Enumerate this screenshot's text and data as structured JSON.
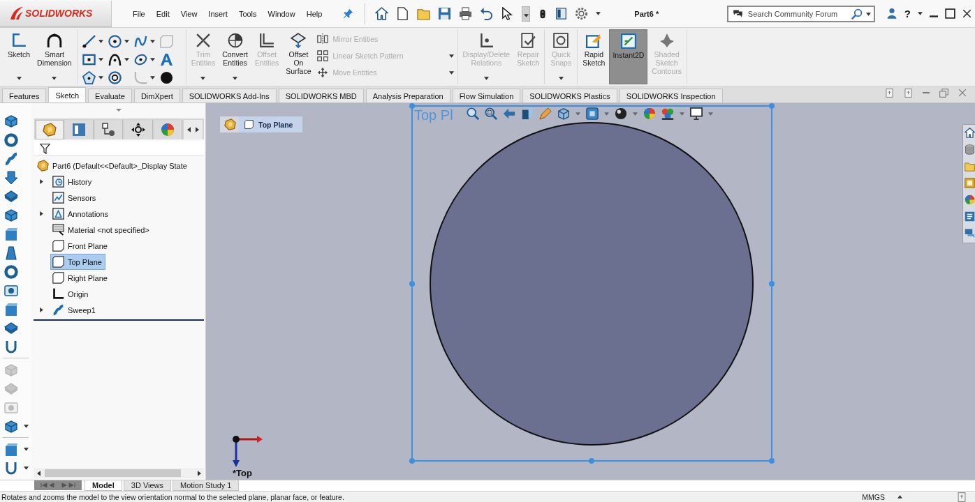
{
  "title_bar": {
    "logo": "SOLIDWORKS",
    "menu": [
      {
        "label": "File"
      },
      {
        "label": "Edit"
      },
      {
        "label": "View"
      },
      {
        "label": "Insert"
      },
      {
        "label": "Tools"
      },
      {
        "label": "Window"
      },
      {
        "label": "Help"
      }
    ],
    "document": "Part6 *",
    "search": {
      "placeholder": "Search Community Forum"
    },
    "help": "?"
  },
  "ribbon": {
    "sections": [
      {
        "items": [
          {
            "kind": "large",
            "label": "Sketch",
            "disabled": false,
            "selected": false,
            "dropdown": true
          },
          {
            "kind": "large",
            "label": "Smart Dimension",
            "disabled": false,
            "selected": false,
            "dropdown": true
          }
        ]
      },
      {
        "items": [
          {
            "kind": "tool",
            "disabled": false,
            "dropdown": true
          },
          {
            "kind": "tool",
            "disabled": false,
            "dropdown": true
          },
          {
            "kind": "tool",
            "disabled": false,
            "dropdown": true
          },
          {
            "kind": "tool",
            "disabled": true,
            "dropdown": false
          },
          {
            "kind": "tool",
            "disabled": false,
            "dropdown": true
          },
          {
            "kind": "tool",
            "disabled": false,
            "dropdown": true
          },
          {
            "kind": "tool",
            "disabled": false,
            "dropdown": true
          },
          {
            "kind": "tool",
            "disabled": false,
            "dropdown": false
          },
          {
            "kind": "tool",
            "disabled": false,
            "dropdown": true
          },
          {
            "kind": "tool",
            "disabled": false,
            "dropdown": false
          },
          {
            "kind": "tool",
            "disabled": true,
            "dropdown": true
          },
          {
            "kind": "tool",
            "disabled": false,
            "dropdown": false
          }
        ]
      },
      {
        "items": [
          {
            "kind": "large",
            "label": "Trim Entities",
            "disabled": true,
            "selected": false,
            "dropdown": true
          },
          {
            "kind": "large",
            "label": "Convert Entities",
            "disabled": false,
            "selected": false,
            "dropdown": true
          },
          {
            "kind": "large",
            "label": "Offset Entities",
            "disabled": true,
            "selected": false,
            "dropdown": false
          },
          {
            "kind": "large",
            "label": "Offset On Surface",
            "disabled": false,
            "selected": false,
            "dropdown": false
          },
          {
            "kind": "small",
            "label": "Mirror Entities",
            "disabled": true,
            "dropdown": false
          },
          {
            "kind": "small",
            "label": "Linear Sketch Pattern",
            "disabled": true,
            "dropdown": true
          },
          {
            "kind": "small",
            "label": "Move Entities",
            "disabled": true,
            "dropdown": true
          }
        ]
      },
      {
        "items": [
          {
            "kind": "large",
            "label": "Display/Delete Relations",
            "disabled": true,
            "selected": false,
            "dropdown": true
          },
          {
            "kind": "large",
            "label": "Repair Sketch",
            "disabled": true,
            "selected": false,
            "dropdown": false
          }
        ]
      },
      {
        "items": [
          {
            "kind": "large",
            "label": "Quick Snaps",
            "disabled": true,
            "selected": false,
            "dropdown": true
          }
        ]
      },
      {
        "items": [
          {
            "kind": "large",
            "label": "Rapid Sketch",
            "disabled": false,
            "selected": false,
            "dropdown": false
          },
          {
            "kind": "large",
            "label": "Instant2D",
            "disabled": false,
            "selected": true,
            "dropdown": false
          },
          {
            "kind": "large",
            "label": "Shaded Sketch Contours",
            "disabled": true,
            "selected": false,
            "dropdown": false
          }
        ]
      }
    ]
  },
  "command_tabs": [
    {
      "label": "Features",
      "selected": false
    },
    {
      "label": "Sketch",
      "selected": true
    },
    {
      "label": "Evaluate",
      "selected": false
    },
    {
      "label": "DimXpert",
      "selected": false
    },
    {
      "label": "SOLIDWORKS Add-Ins",
      "selected": false
    },
    {
      "label": "SOLIDWORKS MBD",
      "selected": false
    },
    {
      "label": "Analysis Preparation",
      "selected": false
    },
    {
      "label": "Flow Simulation",
      "selected": false
    },
    {
      "label": "SOLIDWORKS Plastics",
      "selected": false
    },
    {
      "label": "SOLIDWORKS Inspection",
      "selected": false
    }
  ],
  "side_tools": [
    {
      "tools": [
        {
          "disabled": false,
          "dropdown": false
        },
        {
          "disabled": false,
          "dropdown": false
        },
        {
          "disabled": false,
          "dropdown": false
        },
        {
          "disabled": false,
          "dropdown": false
        },
        {
          "disabled": false,
          "dropdown": false
        },
        {
          "disabled": false,
          "dropdown": false
        },
        {
          "disabled": false,
          "dropdown": false
        },
        {
          "disabled": false,
          "dropdown": false
        },
        {
          "disabled": false,
          "dropdown": false
        },
        {
          "disabled": false,
          "dropdown": false
        },
        {
          "disabled": false,
          "dropdown": false
        },
        {
          "disabled": false,
          "dropdown": false
        },
        {
          "disabled": false,
          "dropdown": false
        }
      ]
    },
    {
      "tools": [
        {
          "disabled": true,
          "dropdown": false
        },
        {
          "disabled": true,
          "dropdown": false
        },
        {
          "disabled": true,
          "dropdown": false
        },
        {
          "disabled": false,
          "dropdown": true
        }
      ]
    },
    {
      "tools": [
        {
          "disabled": false,
          "dropdown": true
        },
        {
          "disabled": false,
          "dropdown": true
        }
      ]
    }
  ],
  "feature_manager": {
    "tabs": [
      {
        "selected": true
      },
      {
        "selected": false
      },
      {
        "selected": false
      },
      {
        "selected": false
      },
      {
        "selected": false
      }
    ],
    "tree": [
      {
        "label": "Part6 (Default<<Default>_Display State",
        "kind": "part",
        "expandable": false,
        "selected": false,
        "children": [
          {
            "label": "History",
            "kind": "history",
            "expandable": true,
            "selected": false
          },
          {
            "label": "Sensors",
            "kind": "sensors",
            "expandable": false,
            "selected": false
          },
          {
            "label": "Annotations",
            "kind": "annotations",
            "expandable": true,
            "selected": false
          },
          {
            "label": "Material <not specified>",
            "kind": "material",
            "expandable": false,
            "selected": false
          },
          {
            "label": "Front Plane",
            "kind": "plane",
            "expandable": false,
            "selected": false
          },
          {
            "label": "Top Plane",
            "kind": "plane",
            "expandable": false,
            "selected": true
          },
          {
            "label": "Right Plane",
            "kind": "plane",
            "expandable": false,
            "selected": false
          },
          {
            "label": "Origin",
            "kind": "origin",
            "expandable": false,
            "selected": false
          },
          {
            "label": "Sweep1",
            "kind": "sweep",
            "expandable": true,
            "selected": false
          }
        ]
      }
    ]
  },
  "viewport": {
    "breadcrumb": "Top Plane",
    "plane_label": "Top Pl",
    "view_label": "*Top"
  },
  "bottom_tabs": [
    {
      "label": "Model",
      "selected": true
    },
    {
      "label": "3D Views",
      "selected": false
    },
    {
      "label": "Motion Study 1",
      "selected": false
    }
  ],
  "status_bar": {
    "message": "Rotates and zooms the model to the view orientation normal to the selected plane, planar face, or feature.",
    "units": "MMGS"
  }
}
